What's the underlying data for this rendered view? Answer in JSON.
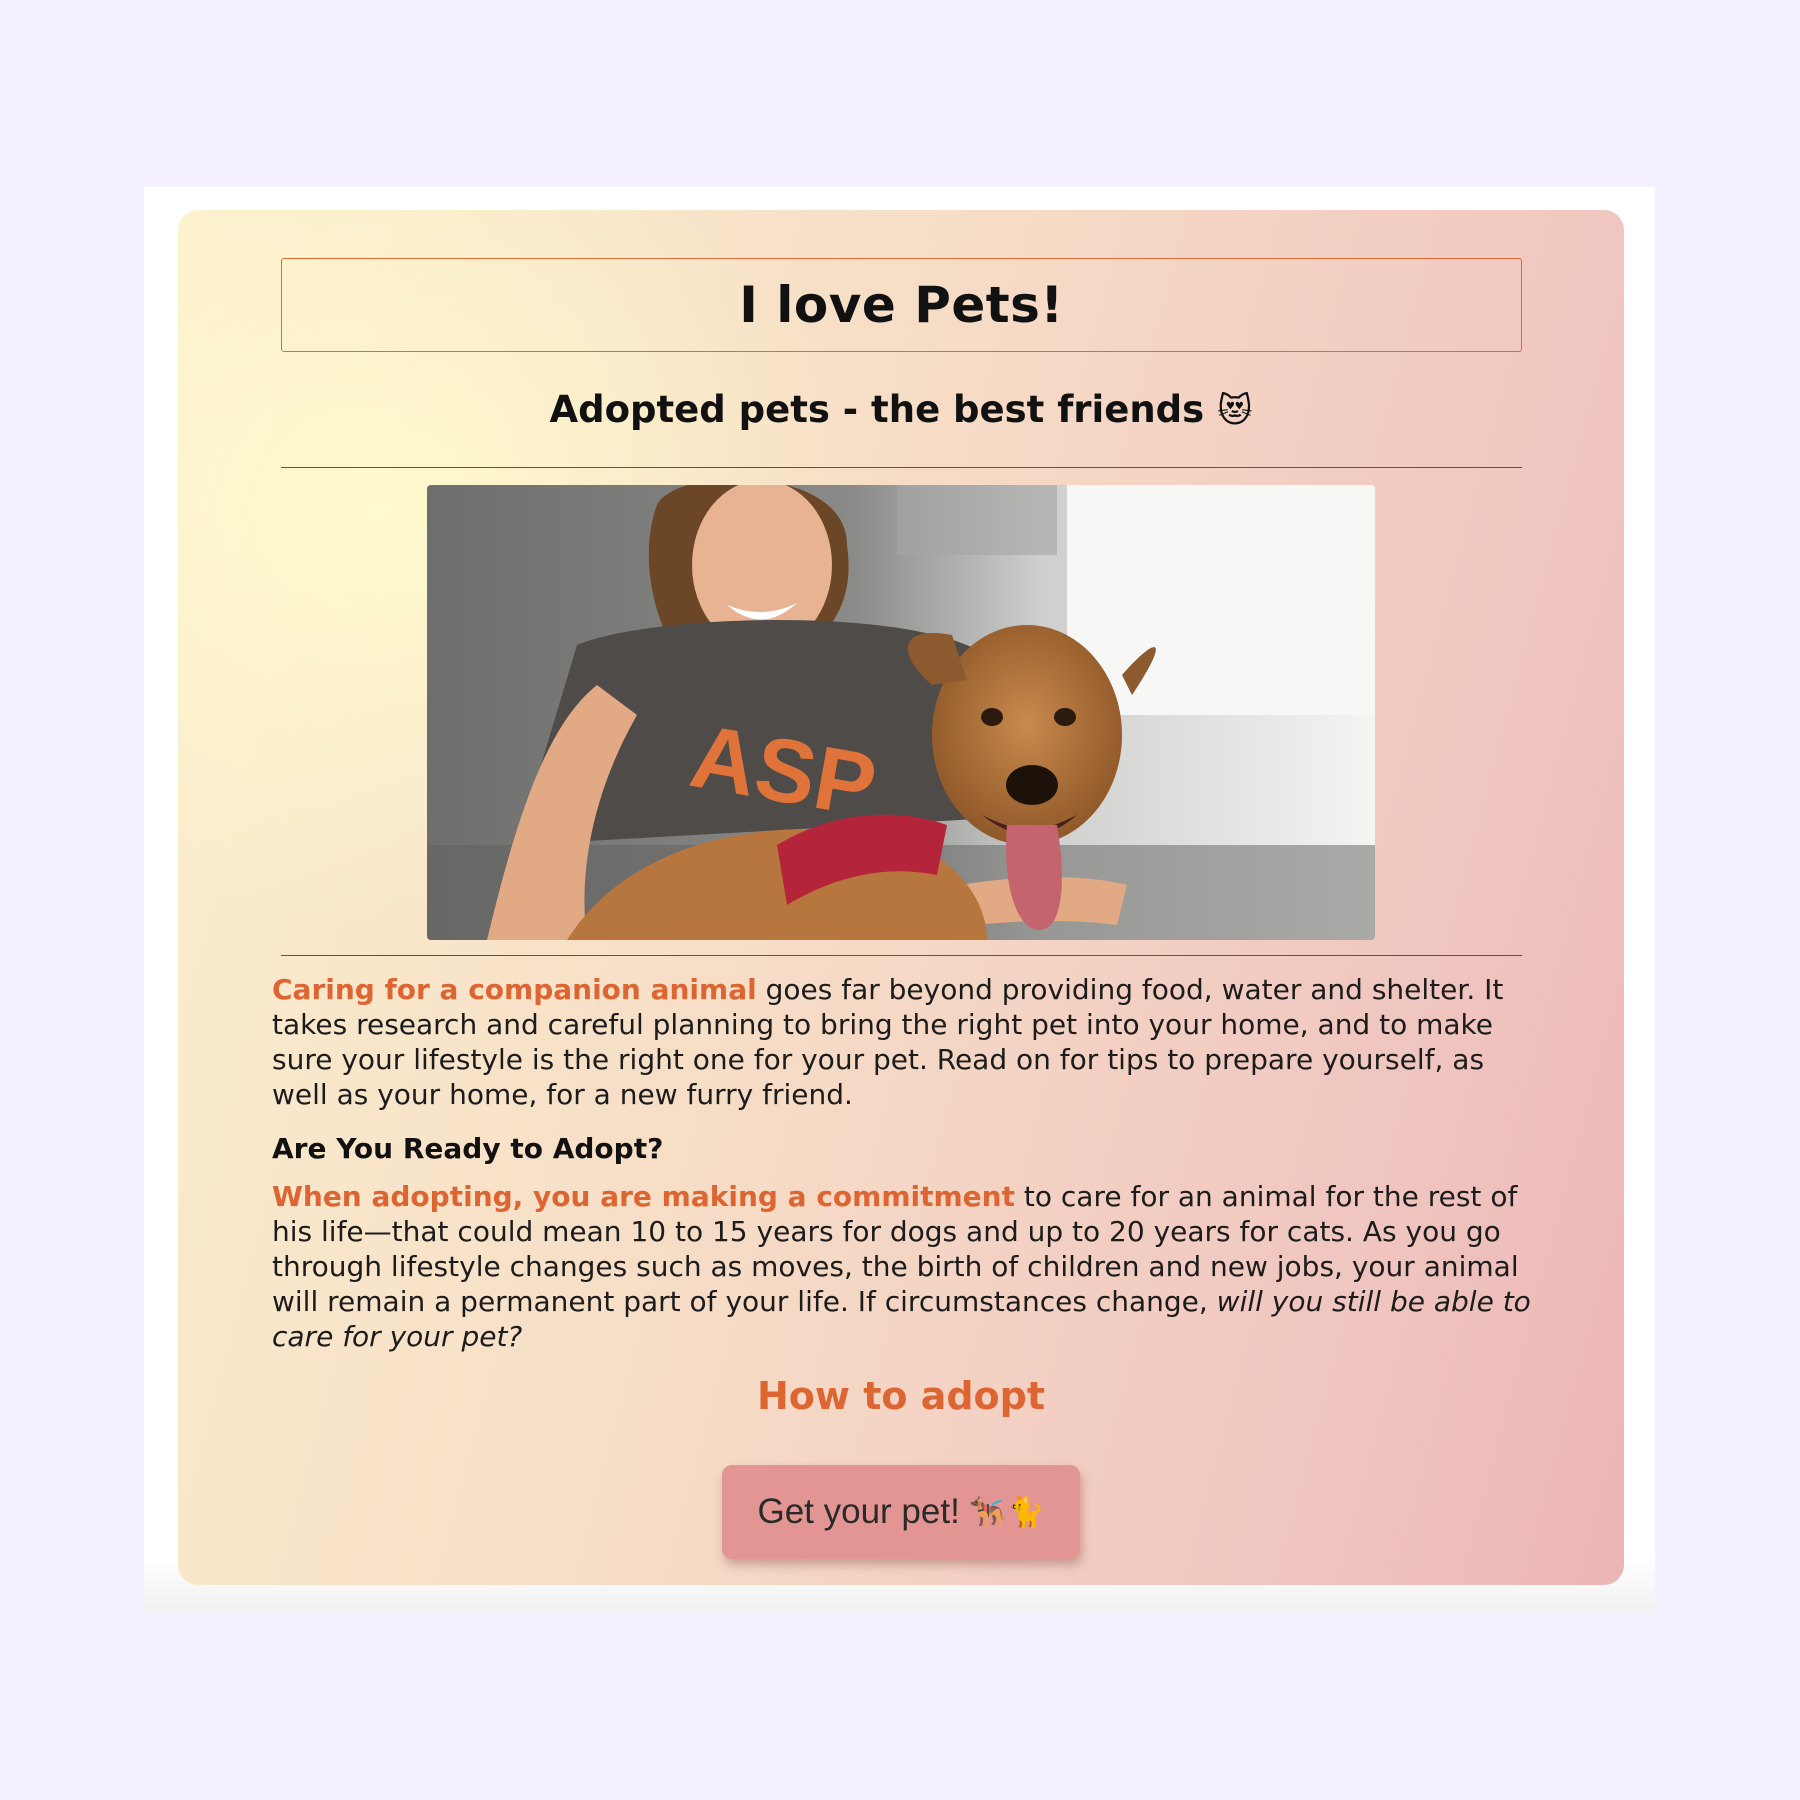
{
  "header": {
    "title": "I love Pets!",
    "subtitle": "Adopted pets - the best friends",
    "subtitle_emoji": "😻"
  },
  "photo": {
    "description_icon": "woman-hugging-dog-photo"
  },
  "intro": {
    "highlight": "Caring for a companion animal",
    "text": " goes far beyond providing food, water and shelter. It takes research and careful planning to bring the right pet into your home, and to make sure your lifestyle is the right one for your pet. Read on for tips to prepare yourself, as well as your home, for a new furry friend."
  },
  "ready": {
    "heading": "Are You Ready to Adopt?",
    "highlight": "When adopting, you are making a commitment",
    "text": " to care for an animal for the rest of his life—that could mean 10 to 15 years for dogs and up to 20 years for cats. As you go through lifestyle changes such as moves, the birth of children and new jobs, your animal will remain a permanent part of your life. If circumstances change, ",
    "emphasis": "will you still be able to care for your pet?"
  },
  "how_to": {
    "heading": "How to adopt",
    "button_label": "Get your pet!",
    "button_emoji": "🐕‍🦺🐈"
  },
  "colors": {
    "accent": "#dc6531",
    "button": "#e39593",
    "page_bg": "#f4f0ff"
  }
}
